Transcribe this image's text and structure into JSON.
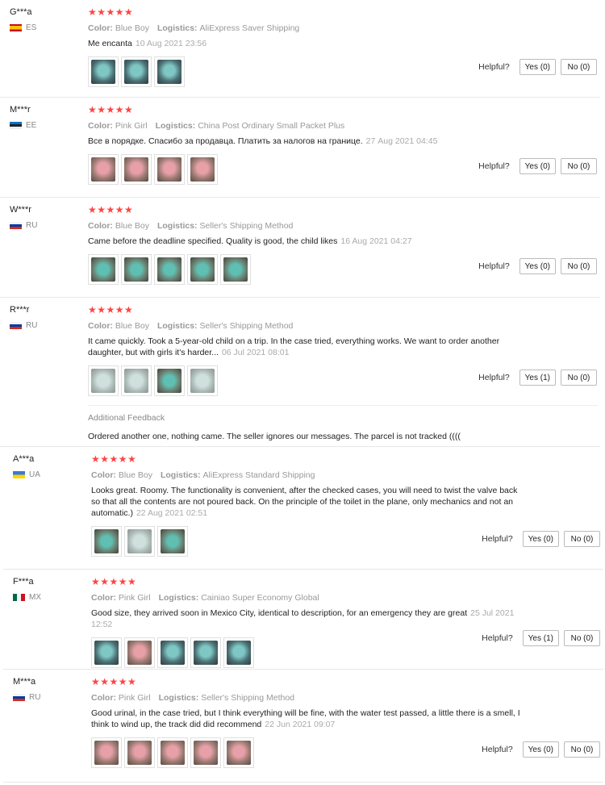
{
  "ui": {
    "helpful_label": "Helpful?",
    "color_label": "Color:",
    "logistics_label": "Logistics:",
    "star_glyphs": "★★★★★",
    "additional_feedback_label": "Additional Feedback"
  },
  "reviews": [
    {
      "user": "G***a",
      "country": "ES",
      "flag": "es",
      "rating": 5,
      "color": "Blue Boy",
      "logistics": "AliExpress Saver Shipping",
      "text": "Me encanta",
      "date": "10 Aug 2021 23:56",
      "photos": [
        "blue",
        "blue",
        "blue"
      ],
      "yes": "Yes (0)",
      "no": "No (0)"
    },
    {
      "user": "M***r",
      "country": "EE",
      "flag": "ee",
      "rating": 5,
      "color": "Pink Girl",
      "logistics": "China Post Ordinary Small Packet Plus",
      "text": "Все в порядке. Спасибо за продавца. Платить за налогов на границе.",
      "date": "27 Aug 2021 04:45",
      "photos": [
        "pink",
        "pink",
        "pink",
        "pink"
      ],
      "yes": "Yes (0)",
      "no": "No (0)"
    },
    {
      "user": "W***r",
      "country": "RU",
      "flag": "ru",
      "rating": 5,
      "color": "Blue Boy",
      "logistics": "Seller's Shipping Method",
      "text": "Came before the deadline specified. Quality is good, the child likes",
      "date": "16 Aug 2021 04:27",
      "photos": [
        "teal",
        "teal",
        "teal",
        "teal",
        "teal"
      ],
      "yes": "Yes (0)",
      "no": "No (0)"
    },
    {
      "user": "R***r",
      "country": "RU",
      "flag": "ru",
      "rating": 5,
      "color": "Blue Boy",
      "logistics": "Seller's Shipping Method",
      "text": "It came quickly. Took a 5-year-old child on a trip. In the case tried, everything works. We want to order another daughter, but with girls it's harder...",
      "date": "06 Jul 2021 08:01",
      "photos": [
        "pale",
        "pale",
        "teal",
        "pale"
      ],
      "yes": "Yes (1)",
      "no": "No (0)",
      "additional": "Ordered another one, nothing came. The seller ignores our messages. The parcel is not tracked (((("
    },
    {
      "user": "A***a",
      "country": "UA",
      "flag": "ua",
      "rating": 5,
      "color": "Blue Boy",
      "logistics": "AliExpress Standard Shipping",
      "text": "Looks great. Roomy. The functionality is convenient, after the checked cases, you will need to twist the valve back so that all the contents are not poured back. On the principle of the toilet in the plane, only mechanics and not an automatic.)",
      "date": "22 Aug 2021 02:51",
      "photos": [
        "teal",
        "pale",
        "teal"
      ],
      "yes": "Yes (0)",
      "no": "No (0)"
    },
    {
      "user": "F***a",
      "country": "MX",
      "flag": "mx",
      "rating": 5,
      "color": "Pink Girl",
      "logistics": "Cainiao Super Economy Global",
      "text": "Good size, they arrived soon in Mexico City, identical to description, for an emergency they are great",
      "date": "25 Jul 2021 12:52",
      "photos": [
        "blue",
        "pink",
        "blue",
        "blue",
        "blue"
      ],
      "yes": "Yes (1)",
      "no": "No (0)"
    },
    {
      "user": "M***a",
      "country": "RU",
      "flag": "ru",
      "rating": 5,
      "color": "Pink Girl",
      "logistics": "Seller's Shipping Method",
      "text": "Good urinal, in the case tried, but I think everything will be fine, with the water test passed, a little there is a smell, I think to wind up, the track did did recommend",
      "date": "22 Jun 2021 09:07",
      "photos": [
        "pink",
        "pink",
        "pink",
        "pink",
        "pink"
      ],
      "yes": "Yes (0)",
      "no": "No (0)"
    }
  ],
  "colors": {
    "star": "#f44444",
    "muted": "#999999",
    "divider": "#e8e8e8"
  }
}
